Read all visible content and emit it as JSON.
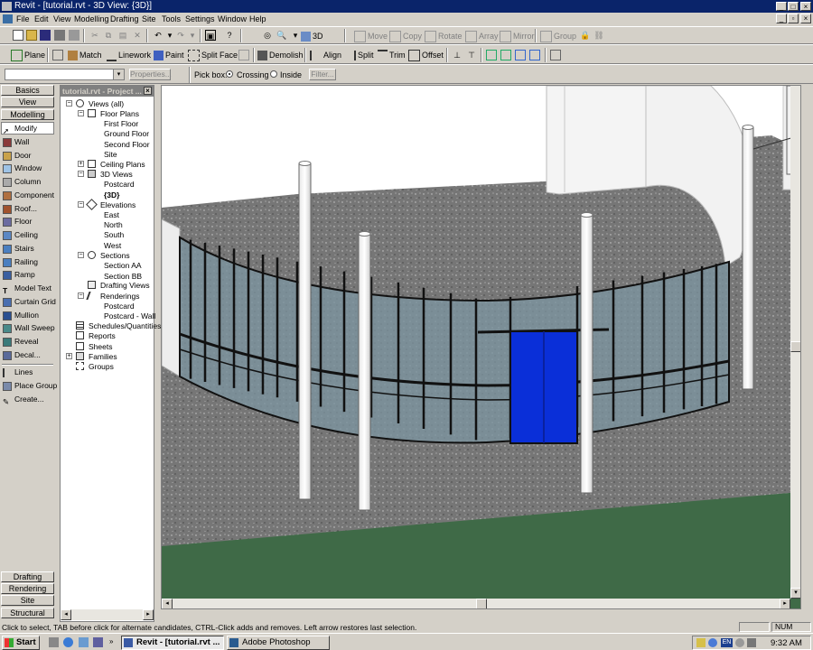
{
  "window": {
    "title": "Revit - [tutorial.rvt - 3D View: {3D}]",
    "caption_buttons": [
      "_",
      "□",
      "×"
    ]
  },
  "menu": [
    "File",
    "Edit",
    "View",
    "Modelling",
    "Drafting",
    "Site",
    "Tools",
    "Settings",
    "Window",
    "Help"
  ],
  "toolbar1": {
    "threed_label": "3D",
    "move": "Move",
    "copy": "Copy",
    "rotate": "Rotate",
    "array": "Array",
    "mirror": "Mirror",
    "group": "Group"
  },
  "toolbar2": {
    "plane": "Plane",
    "match": "Match",
    "linework": "Linework",
    "paint": "Paint",
    "split_face": "Split Face",
    "demolish": "Demolish",
    "align": "Align",
    "split": "Split",
    "trim": "Trim",
    "offset": "Offset"
  },
  "optionsbar": {
    "properties": "Properties...",
    "pick_box": "Pick box:",
    "crossing": "Crossing",
    "inside": "Inside",
    "filter": "Filter..."
  },
  "designbar": {
    "tabs_top": [
      "Basics",
      "View",
      "Modelling"
    ],
    "tools": [
      "Modify",
      "Wall",
      "Door",
      "Window",
      "Column",
      "Component",
      "Roof...",
      "Floor",
      "Ceiling",
      "Stairs",
      "Railing",
      "Ramp",
      "Model Text",
      "Curtain Grid",
      "Mullion",
      "Wall Sweep",
      "Reveal",
      "Decal...",
      "Lines",
      "Place Group",
      "Create..."
    ],
    "tabs_bottom": [
      "Drafting",
      "Rendering",
      "Site",
      "Structural"
    ]
  },
  "browser": {
    "title": "tutorial.rvt - Project ...",
    "views_all": "Views (all)",
    "floor_plans": "Floor Plans",
    "floor_plan_items": [
      "First Floor",
      "Ground Floor",
      "Second Floor",
      "Site"
    ],
    "ceiling_plans": "Ceiling Plans",
    "views_3d": "3D Views",
    "views_3d_items": [
      "Postcard",
      "{3D}"
    ],
    "elevations": "Elevations",
    "elevation_items": [
      "East",
      "North",
      "South",
      "West"
    ],
    "sections": "Sections",
    "section_items": [
      "Section AA",
      "Section BB"
    ],
    "drafting_views": "Drafting Views",
    "renderings": "Renderings",
    "rendering_items": [
      "Postcard",
      "Postcard - Wall"
    ],
    "schedules": "Schedules/Quantities",
    "reports": "Reports",
    "sheets": "Sheets",
    "families": "Families",
    "groups": "Groups"
  },
  "status": {
    "message": "Click to select, TAB before click for alternate candidates, CTRL-Click adds and removes. Left arrow restores last selection.",
    "num": "NUM"
  },
  "taskbar": {
    "start": "Start",
    "tasks": [
      "Revit - [tutorial.rvt ...",
      "Adobe Photoshop"
    ],
    "lang": "EN",
    "clock": "9:32 AM"
  },
  "colors": {
    "titlebar": "#0a246a",
    "floor": "#747474",
    "grass": "#3f6a47",
    "glass": "#7a8f98",
    "door": "#0a2fd8",
    "wall": "#f0f0f0"
  }
}
